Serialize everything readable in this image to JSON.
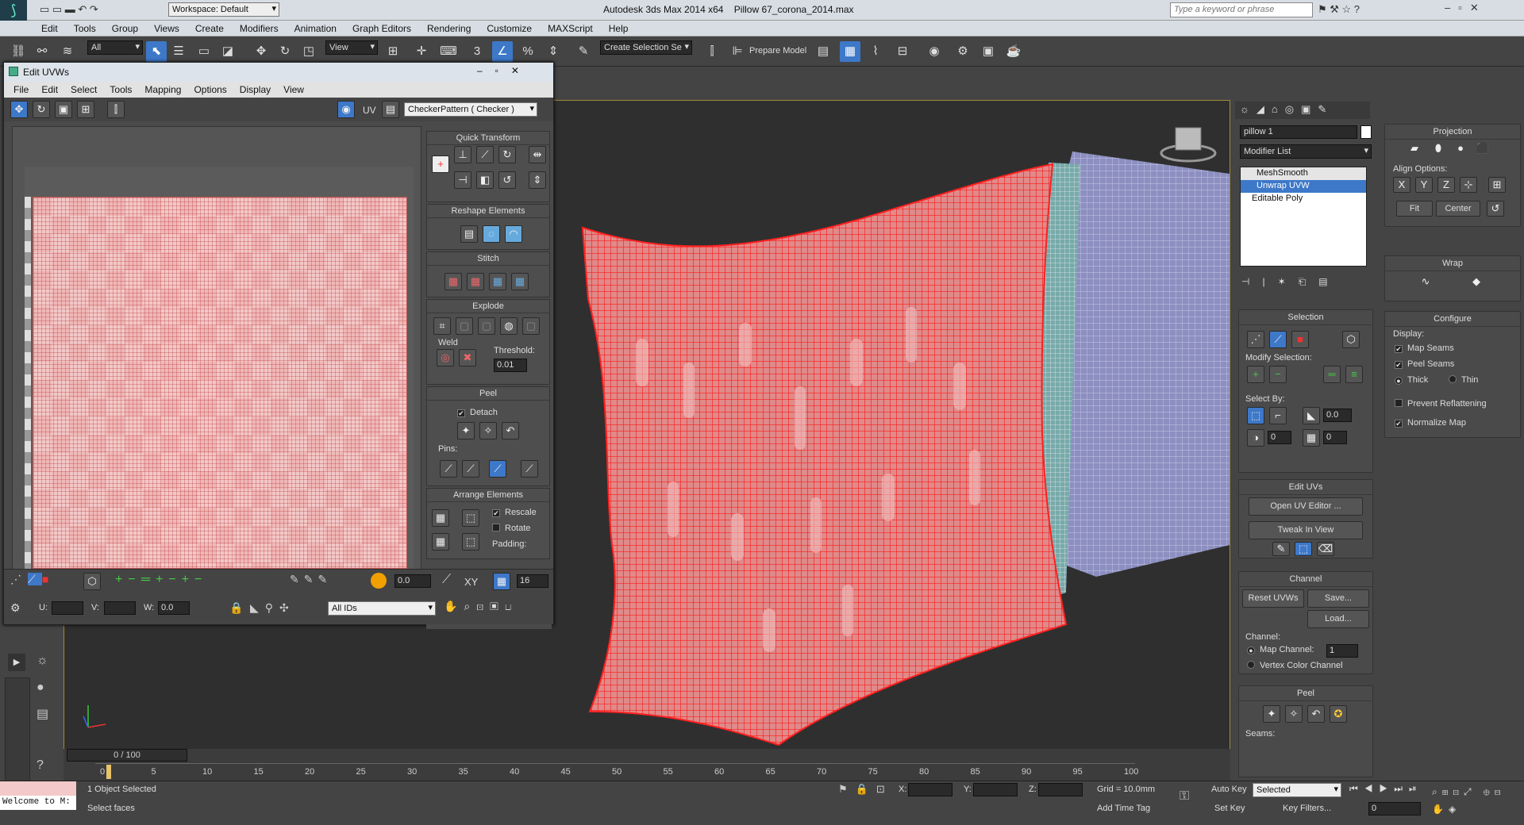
{
  "app": {
    "title": "Autodesk 3ds Max  2014 x64",
    "file": "Pillow 67_corona_2014.max",
    "workspace": "Workspace: Default",
    "search_placeholder": "Type a keyword or phrase"
  },
  "menu": [
    "Edit",
    "Tools",
    "Group",
    "Views",
    "Create",
    "Modifiers",
    "Animation",
    "Graph Editors",
    "Rendering",
    "Customize",
    "MAXScript",
    "Help"
  ],
  "toolbar": {
    "filter": "All",
    "ref_coord": "View",
    "selection_set": "Create Selection Se",
    "prepare_model": "Prepare Model",
    "snap_count": "3",
    "angle_snap": "%"
  },
  "uv_editor": {
    "title": "Edit UVWs",
    "menu": [
      "File",
      "Edit",
      "Select",
      "Tools",
      "Mapping",
      "Options",
      "Display",
      "View"
    ],
    "uv_label": "UV",
    "map_dropdown": "CheckerPattern  ( Checker )",
    "quick_transform": "Quick Transform",
    "reshape_elements": "Reshape Elements",
    "stitch": "Stitch",
    "explode": "Explode",
    "weld": "Weld",
    "threshold_label": "Threshold:",
    "threshold_value": "0.01",
    "peel": "Peel",
    "detach": "Detach",
    "pins": "Pins:",
    "arrange_elements": "Arrange Elements",
    "rescale": "Rescale",
    "rotate": "Rotate",
    "padding": "Padding:",
    "spin_value": "0.0",
    "xy_label": "XY",
    "grid_value": "16",
    "u_label": "U:",
    "v_label": "V:",
    "w_label": "W:",
    "w_value": "0.0",
    "ids_dropdown": "All IDs"
  },
  "viewport": {},
  "right_panel": {
    "object_name": "pillow 1",
    "modifier_list": "Modifier List",
    "stack": [
      "MeshSmooth",
      "Unwrap UVW",
      "Editable Poly"
    ],
    "selection": "Selection",
    "modify_selection": "Modify Selection:",
    "select_by": "Select By:",
    "angle_value": "0.0",
    "spin1": "0",
    "spin2": "0",
    "edit_uvs": "Edit UVs",
    "open_uv_editor": "Open UV Editor ...",
    "tweak_in_view": "Tweak In View",
    "channel": "Channel",
    "reset_uvws": "Reset UVWs",
    "save": "Save...",
    "load": "Load...",
    "channel_label": "Channel:",
    "map_channel": "Map Channel:",
    "map_channel_value": "1",
    "vertex_color_channel": "Vertex Color Channel",
    "peel": "Peel",
    "seams": "Seams:",
    "projection": "Projection",
    "align_options": "Align Options:",
    "align_x": "X",
    "align_y": "Y",
    "align_z": "Z",
    "fit": "Fit",
    "center": "Center",
    "wrap": "Wrap",
    "configure": "Configure",
    "display": "Display:",
    "map_seams": "Map Seams",
    "peel_seams": "Peel Seams",
    "thick": "Thick",
    "thin": "Thin",
    "prevent_reflattening": "Prevent Reflattening",
    "normalize_map": "Normalize Map"
  },
  "timeline": {
    "frame": "0 / 100",
    "ticks": [
      "0",
      "5",
      "10",
      "15",
      "20",
      "25",
      "30",
      "35",
      "40",
      "45",
      "50",
      "55",
      "60",
      "65",
      "70",
      "75",
      "80",
      "85",
      "90",
      "95",
      "100"
    ]
  },
  "status": {
    "welcome": "Welcome to M:",
    "objects": "1 Object Selected",
    "prompt": "Select faces",
    "x": "X:",
    "y": "Y:",
    "z": "Z:",
    "grid": "Grid = 10.0mm",
    "add_time_tag": "Add Time Tag",
    "auto_key": "Auto Key",
    "key_mode": "Selected",
    "set_key": "Set Key",
    "key_filters": "Key Filters...",
    "frame_value": "0"
  },
  "colors": {
    "accent": "#3d78c9",
    "wire": "#ff2020",
    "viewport_bg": "#2f2f2f"
  }
}
